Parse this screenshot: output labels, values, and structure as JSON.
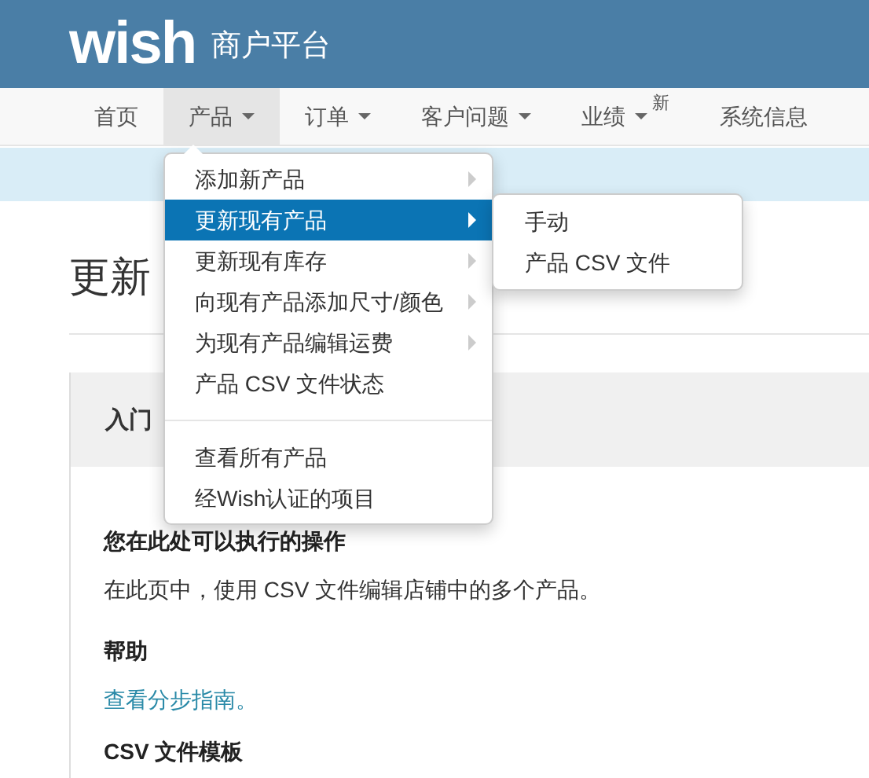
{
  "header": {
    "logo": "wish",
    "title": "商户平台"
  },
  "nav": [
    {
      "label": "首页",
      "dropdown": false,
      "selected": false
    },
    {
      "label": "产品",
      "dropdown": true,
      "selected": true
    },
    {
      "label": "订单",
      "dropdown": true,
      "selected": false
    },
    {
      "label": "客户问题",
      "dropdown": true,
      "selected": false
    },
    {
      "label": "业绩",
      "dropdown": true,
      "selected": false,
      "badge": "新"
    },
    {
      "label": "系统信息",
      "dropdown": false,
      "selected": false
    }
  ],
  "page": {
    "heading": "更新",
    "card_title": "入门",
    "sections": [
      {
        "kind": "heading",
        "text": "您在此处可以执行的操作"
      },
      {
        "kind": "paragraph",
        "text": "在此页中，使用 CSV 文件编辑店铺中的多个产品。"
      },
      {
        "kind": "heading",
        "text": "帮助"
      },
      {
        "kind": "link",
        "text": "查看分步指南。"
      },
      {
        "kind": "heading",
        "text": "CSV 文件模板"
      }
    ]
  },
  "menu": {
    "items": [
      {
        "kind": "item",
        "label": "添加新产品",
        "submenu": true,
        "selected": false
      },
      {
        "kind": "item",
        "label": "更新现有产品",
        "submenu": true,
        "selected": true
      },
      {
        "kind": "item",
        "label": "更新现有库存",
        "submenu": true,
        "selected": false
      },
      {
        "kind": "item",
        "label": "向现有产品添加尺寸/颜色",
        "submenu": true,
        "selected": false
      },
      {
        "kind": "item",
        "label": "为现有产品编辑运费",
        "submenu": true,
        "selected": false
      },
      {
        "kind": "item",
        "label": "产品 CSV 文件状态",
        "submenu": false,
        "selected": false
      },
      {
        "kind": "divider"
      },
      {
        "kind": "item",
        "label": "查看所有产品",
        "submenu": false,
        "selected": false
      },
      {
        "kind": "item",
        "label": "经Wish认证的项目",
        "submenu": false,
        "selected": false
      }
    ],
    "submenu": [
      "手动",
      "产品 CSV 文件"
    ]
  }
}
